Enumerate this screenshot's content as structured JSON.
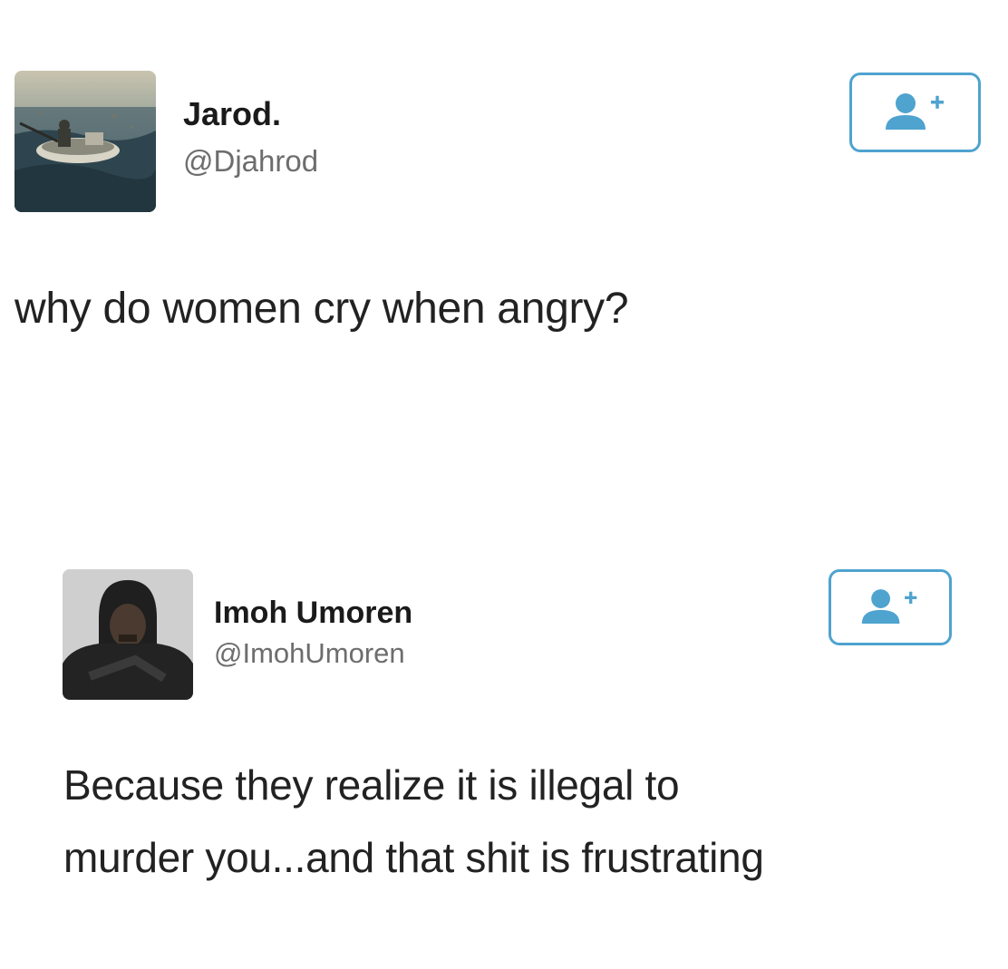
{
  "tweets": [
    {
      "name": "Jarod.",
      "handle": "@Djahrod",
      "avatar_icon": "boat-photo-avatar",
      "follow_icon": "add-user-icon",
      "lines": [
        "why do women cry when angry?"
      ]
    },
    {
      "name": "Imoh Umoren",
      "handle": "@ImohUmoren",
      "avatar_icon": "person-photo-avatar",
      "follow_icon": "add-user-icon",
      "lines": [
        "Because they realize it is illegal to",
        "murder you...and that shit is frustrating"
      ]
    }
  ],
  "colors": {
    "follow_border": "#4fa3cf",
    "follow_icon": "#4fa3cf",
    "name": "#1a1a1a",
    "handle": "#6d6d6d",
    "text": "#222222"
  }
}
